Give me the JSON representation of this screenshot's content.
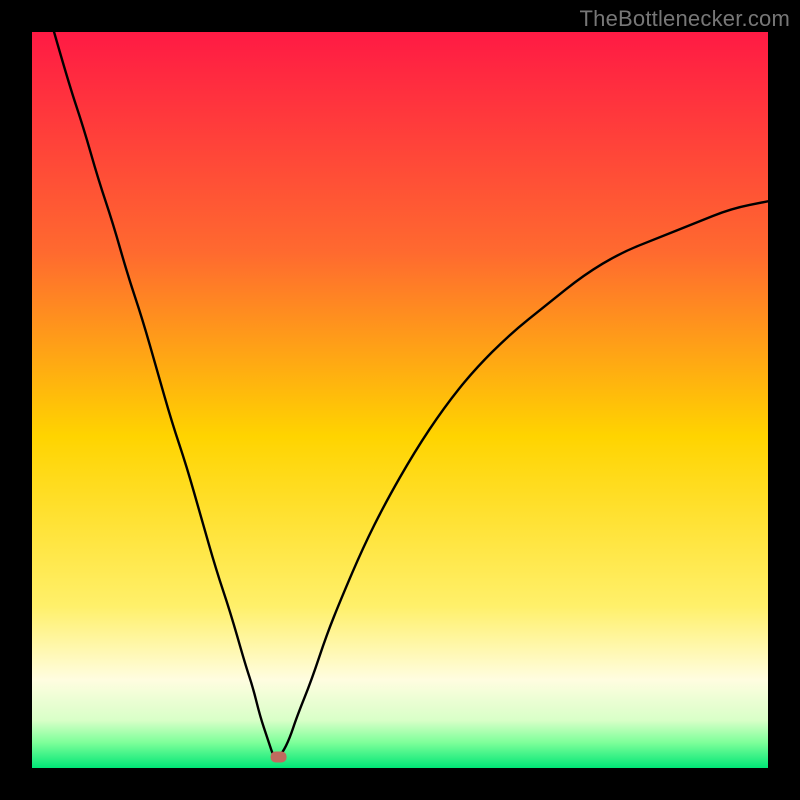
{
  "watermark_text": "TheBottlenecker.com",
  "chart_data": {
    "type": "line",
    "title": "",
    "xlabel": "",
    "ylabel": "",
    "xlim": [
      0,
      100
    ],
    "ylim": [
      0,
      100
    ],
    "x_minimum": 33,
    "marker": {
      "x": 33.5,
      "y": 1.5,
      "color": "#c06a5e"
    },
    "gradient_stops": [
      {
        "offset": 0,
        "color": "#ff1a44"
      },
      {
        "offset": 0.3,
        "color": "#ff6a2f"
      },
      {
        "offset": 0.55,
        "color": "#ffd400"
      },
      {
        "offset": 0.78,
        "color": "#fff06a"
      },
      {
        "offset": 0.88,
        "color": "#fffde0"
      },
      {
        "offset": 0.935,
        "color": "#d9ffc8"
      },
      {
        "offset": 0.965,
        "color": "#7fff9a"
      },
      {
        "offset": 1.0,
        "color": "#00e676"
      }
    ],
    "series": [
      {
        "name": "bottleneck-curve",
        "x": [
          3,
          5,
          7,
          9,
          11,
          13,
          15,
          17,
          19,
          21,
          23,
          25,
          27,
          29,
          30,
          31,
          32,
          33,
          34,
          35,
          36,
          38,
          40,
          42,
          45,
          48,
          52,
          56,
          60,
          65,
          70,
          75,
          80,
          85,
          90,
          95,
          100
        ],
        "y": [
          100,
          93,
          87,
          80,
          74,
          67,
          61,
          54,
          47,
          41,
          34,
          27,
          21,
          14,
          11,
          7,
          4,
          1,
          2,
          4,
          7,
          12,
          18,
          23,
          30,
          36,
          43,
          49,
          54,
          59,
          63,
          67,
          70,
          72,
          74,
          76,
          77
        ]
      }
    ]
  }
}
